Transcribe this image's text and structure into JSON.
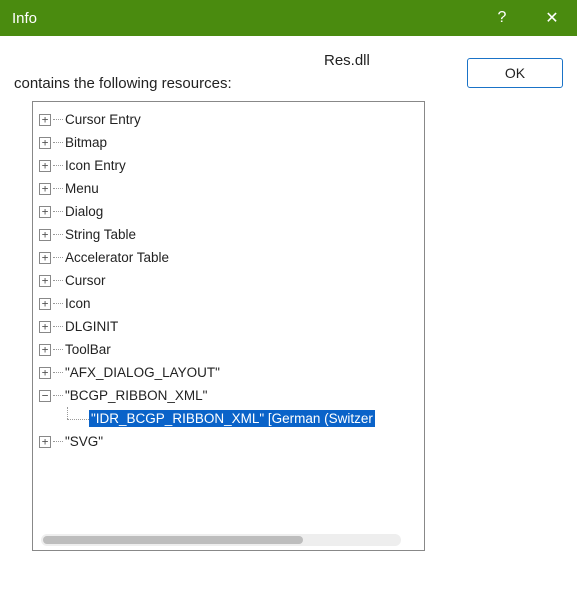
{
  "window": {
    "title": "Info",
    "help_glyph": "?",
    "close_glyph": "✕"
  },
  "body": {
    "filename": "Res.dll",
    "caption": "contains the following resources:"
  },
  "buttons": {
    "ok": "OK"
  },
  "tree": {
    "nodes": [
      {
        "label": "Cursor Entry",
        "state": "collapsed"
      },
      {
        "label": "Bitmap",
        "state": "collapsed"
      },
      {
        "label": "Icon Entry",
        "state": "collapsed"
      },
      {
        "label": "Menu",
        "state": "collapsed"
      },
      {
        "label": "Dialog",
        "state": "collapsed"
      },
      {
        "label": "String Table",
        "state": "collapsed"
      },
      {
        "label": "Accelerator Table",
        "state": "collapsed"
      },
      {
        "label": "Cursor",
        "state": "collapsed"
      },
      {
        "label": "Icon",
        "state": "collapsed"
      },
      {
        "label": "DLGINIT",
        "state": "collapsed"
      },
      {
        "label": "ToolBar",
        "state": "collapsed"
      },
      {
        "label": "\"AFX_DIALOG_LAYOUT\"",
        "state": "collapsed"
      },
      {
        "label": "\"BCGP_RIBBON_XML\"",
        "state": "expanded",
        "children": [
          {
            "label": "\"IDR_BCGP_RIBBON_XML\" [German (Switzer",
            "selected": true
          }
        ]
      },
      {
        "label": "\"SVG\"",
        "state": "collapsed"
      }
    ]
  },
  "glyphs": {
    "plus": "+",
    "minus": "−"
  }
}
